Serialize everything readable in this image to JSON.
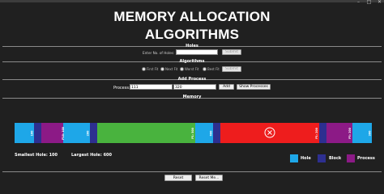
{
  "window": {
    "controls": [
      "–",
      "□",
      "✕"
    ]
  },
  "header": {
    "line1": "MEMORY ALLOCATION",
    "line2": "ALGORITHMS"
  },
  "holes": {
    "section_title": "Holes",
    "prompt": "Enter No. of Holes:",
    "value": "",
    "submit_label": "Submit"
  },
  "algorithms": {
    "section_title": "Algorithms",
    "options": [
      "First Fit",
      "Next Fit",
      "Worst Fit",
      "Best Fit"
    ],
    "submit_label": "Submit"
  },
  "add_process": {
    "section_title": "Add Process",
    "label": "Process:",
    "name_value": "111",
    "size_value": "320",
    "add_label": "Add",
    "show_label": "Show Processes"
  },
  "memory": {
    "section_title": "Memory",
    "labels": [
      "100",
      "P18: 100",
      "200",
      "P1: 500",
      "600",
      "P1: 200",
      "P3: 200",
      "300"
    ]
  },
  "stats": {
    "smallest": "Smallest Hole: 100",
    "largest": "Largest Hole: 600"
  },
  "legend": [
    {
      "label": "Hole",
      "color": "#1ea7e8"
    },
    {
      "label": "Block",
      "color": "#2d2f90"
    },
    {
      "label": "Process",
      "color": "#8c1a86"
    }
  ],
  "colors": {
    "hole": "#1ea7e8",
    "block": "#2d2f90",
    "process": "#8c1a86",
    "green": "#49b33e",
    "red": "#ee1d1d"
  },
  "buttons": {
    "reset": "Reset",
    "reset_memory": "Reset Me..."
  }
}
